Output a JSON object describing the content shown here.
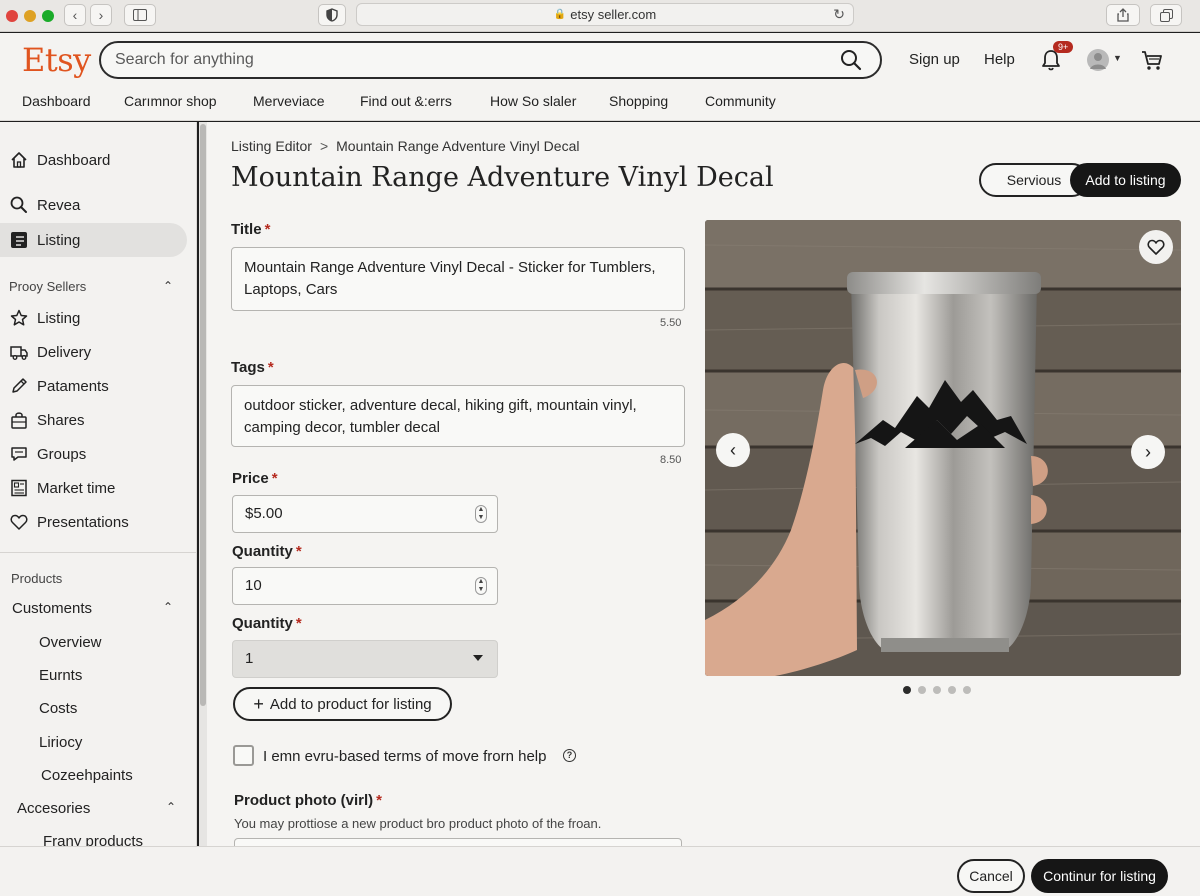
{
  "browser": {
    "url": "etsy seller.com"
  },
  "header": {
    "logo": "Etsy",
    "search_placeholder": "Search for anything",
    "sign_up": "Sign up",
    "help": "Help",
    "notification_count": "9+",
    "accent_color": "#e0541f"
  },
  "nav": {
    "items": [
      "Dashboard",
      "Carımnor shop",
      "Merveviace",
      "Find out &:errs",
      "How So slaler",
      "Shopping",
      "Community"
    ]
  },
  "sidebar": {
    "top_items": [
      {
        "label": "Dashboard",
        "icon": "home-icon"
      },
      {
        "label": "Revea",
        "icon": "search-icon"
      },
      {
        "label": "Listing",
        "icon": "listing-icon",
        "active": true
      }
    ],
    "section1": {
      "title": "Prooy Sellers",
      "items": [
        {
          "label": "Listing",
          "icon": "star-icon"
        },
        {
          "label": "Delivery",
          "icon": "truck-icon"
        },
        {
          "label": "Pataments",
          "icon": "pen-icon"
        },
        {
          "label": "Shares",
          "icon": "bag-icon"
        },
        {
          "label": "Groups",
          "icon": "message-icon"
        },
        {
          "label": "Market time",
          "icon": "document-icon"
        },
        {
          "label": "Presentations",
          "icon": "heart-icon"
        }
      ]
    },
    "products_label": "Products",
    "customers": {
      "title": "Customents",
      "items": [
        "Overview",
        "Eurnts",
        "Costs",
        "Liriocy",
        "Cozeehpaints"
      ]
    },
    "accessories": {
      "title": "Accesories",
      "items": [
        "Frany products"
      ]
    }
  },
  "main": {
    "breadcrumb": {
      "parent": "Listing Editor",
      "separator": ">",
      "current": "Mountain Range Adventure Vinyl Decal"
    },
    "page_title": "Mountain Range Adventure Vinyl Decal",
    "secondary_button": "Servious",
    "primary_button": "Add to listing",
    "title_field": {
      "label": "Title",
      "value": "Mountain Range Adventure Vinyl Decal - Sticker for Tumblers, Laptops, Cars",
      "count": "5.50"
    },
    "tags_field": {
      "label": "Tags",
      "value": "outdoor sticker, adventure decal, hiking gift, mountain vinyl, camping decor, tumbler decal",
      "count": "8.50"
    },
    "price_field": {
      "label": "Price",
      "value": "$5.00"
    },
    "quantity_field": {
      "label": "Quantity",
      "value": "10"
    },
    "quantity_select": {
      "label": "Quantity",
      "value": "1"
    },
    "add_product_button": "Add to product for listing",
    "terms_label": "I emn evru-based terms of move frorn help",
    "photo": {
      "label": "Product photo (virl)",
      "hint": "You may prottiose a new product bro product photo of the froan."
    },
    "carousel": {
      "total": 5,
      "active": 1
    }
  },
  "footer": {
    "cancel": "Cancel",
    "continue": "Continur for listing"
  },
  "required_mark": "*"
}
